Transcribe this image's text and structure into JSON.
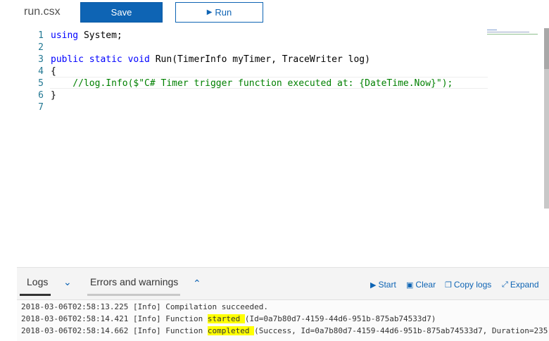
{
  "toolbar": {
    "filename": "run.csx",
    "save_label": "Save",
    "run_label": "Run",
    "run_icon": "play-icon"
  },
  "editor": {
    "lines": [
      {
        "n": "1",
        "segments": [
          {
            "t": "using",
            "c": "kw"
          },
          {
            "t": " System;",
            "c": ""
          }
        ]
      },
      {
        "n": "2",
        "segments": []
      },
      {
        "n": "3",
        "segments": [
          {
            "t": "public static void",
            "c": "kw"
          },
          {
            "t": " Run(TimerInfo myTimer, TraceWriter log)",
            "c": ""
          }
        ]
      },
      {
        "n": "4",
        "segments": [
          {
            "t": "{",
            "c": ""
          }
        ]
      },
      {
        "n": "5",
        "segments": [
          {
            "t": "    //log.Info($\"C# Timer trigger function executed at: {DateTime.Now}\");",
            "c": "cm"
          }
        ]
      },
      {
        "n": "6",
        "segments": [
          {
            "t": "}",
            "c": ""
          }
        ]
      },
      {
        "n": "7",
        "segments": []
      }
    ]
  },
  "logs": {
    "tab_logs": "Logs",
    "tab_errors": "Errors and warnings",
    "start_label": "Start",
    "clear_label": "Clear",
    "copy_label": "Copy logs",
    "expand_label": "Expand",
    "lines": [
      {
        "parts": [
          {
            "t": "2018-03-06T02:58:13.225 [Info] Compilation succeeded.",
            "h": false
          }
        ]
      },
      {
        "parts": [
          {
            "t": "2018-03-06T02:58:14.421 [Info] Function ",
            "h": false
          },
          {
            "t": "started ",
            "h": true
          },
          {
            "t": "(Id=0a7b80d7-4159-44d6-951b-875ab74533d7)",
            "h": false
          }
        ]
      },
      {
        "parts": [
          {
            "t": "2018-03-06T02:58:14.662 [Info] Function ",
            "h": false
          },
          {
            "t": "completed ",
            "h": true
          },
          {
            "t": "(Success, Id=0a7b80d7-4159-44d6-951b-875ab74533d7, Duration=235",
            "h": false
          }
        ]
      }
    ]
  },
  "colors": {
    "accent": "#0e64b4",
    "keyword": "#0000ff",
    "comment": "#008000",
    "highlight": "#ffff00"
  }
}
